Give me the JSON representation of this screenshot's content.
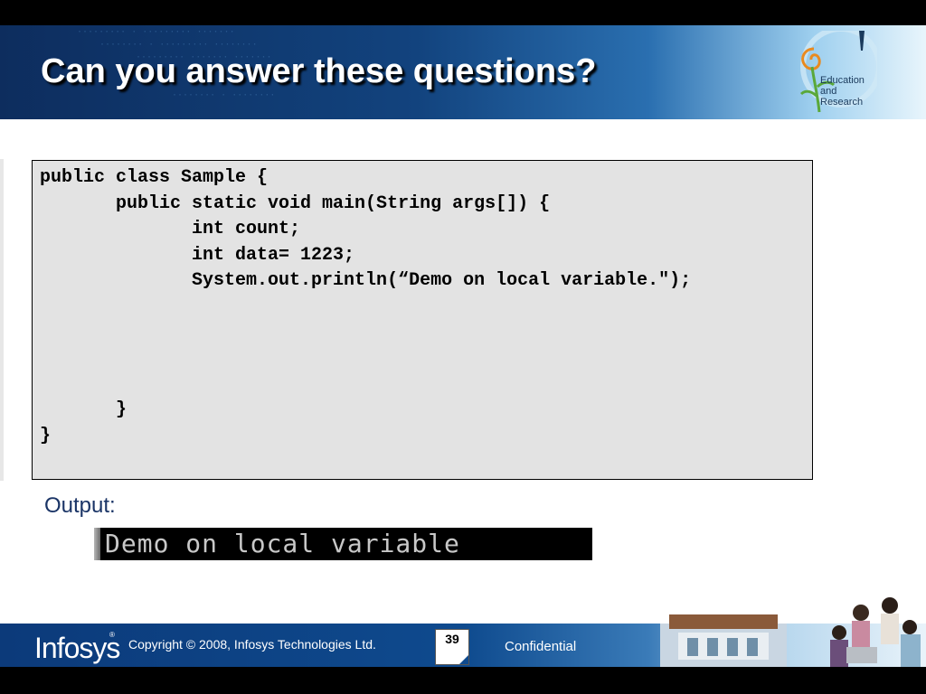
{
  "slide": {
    "title": "Can you answer these questions?"
  },
  "logo": {
    "lines": [
      "Education",
      "and",
      "Research"
    ]
  },
  "code": {
    "text": "public class Sample {\n       public static void main(String args[]) {\n              int count;\n              int data= 1223;\n              System.out.println(“Demo on local variable.\");\n\n\n\n\n       }\n}"
  },
  "output": {
    "label": "Output:",
    "console_text": "Demo on local variable"
  },
  "footer": {
    "brand": "Infosys",
    "registered_mark": "®",
    "copyright": "Copyright © 2008, Infosys Technologies Ltd.",
    "page_number": "39",
    "confidential": "Confidential"
  },
  "colors": {
    "header_dark": "#0d2d5e",
    "title_text": "#ffffff",
    "code_bg": "#e3e3e3",
    "output_label": "#1a3466",
    "footer_blue": "#0e4a8e"
  },
  "icons": [
    "education-research-logo-icon",
    "campus-photo-image"
  ]
}
